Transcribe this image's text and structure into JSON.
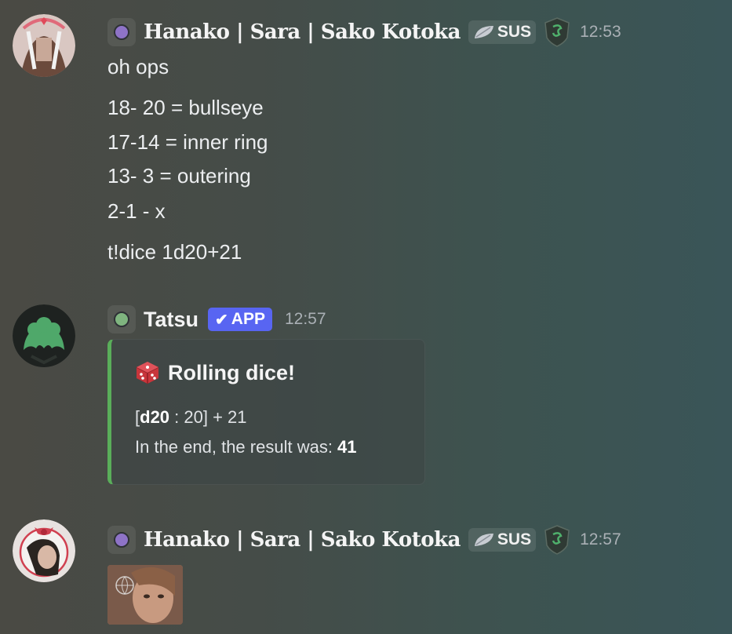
{
  "messages": [
    {
      "username": "Hanako | Sara | Sako Kotoka",
      "tag": "SUS",
      "time": "12:53",
      "status_color": "#8e73c7",
      "lines": [
        "oh ops",
        "18- 20 = bullseye",
        "17-14 = inner ring",
        "13- 3 = outering",
        "2-1 - x",
        "t!dice 1d20+21"
      ]
    },
    {
      "username": "Tatsu",
      "badge": "APP",
      "time": "12:57",
      "status_color": "#7fb47f",
      "embed": {
        "title": "Rolling dice!",
        "roll_open": "[",
        "roll_die": "d20",
        "roll_rest": " : 20] + 21",
        "result_prefix": "In the end, the result was: ",
        "result_value": "41",
        "accent": "#5aae5a"
      }
    },
    {
      "username": "Hanako | Sara | Sako Kotoka",
      "tag": "SUS",
      "time": "12:57",
      "status_color": "#8e73c7"
    }
  ],
  "colors": {
    "app_badge": "#5865f2",
    "timestamp": "#aab0b5"
  },
  "icons": {
    "tag": "leaf-icon",
    "guild": "dragon-shield-icon",
    "dice": "dice-icon",
    "badge_check": "check-icon"
  }
}
